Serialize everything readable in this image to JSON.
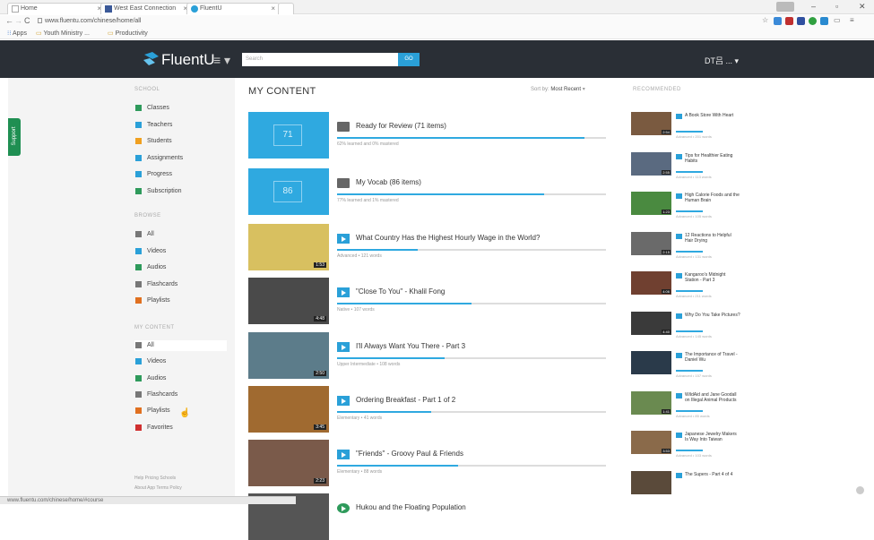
{
  "browser": {
    "tabs": [
      {
        "label": "Home"
      },
      {
        "label": "West East Connection"
      },
      {
        "label": "FluentU"
      }
    ],
    "url": "www.fluentu.com/chinese/home/all",
    "bookmarks": [
      "Apps",
      "Youth Ministry ...",
      "Productivity"
    ],
    "user_badge": "",
    "status_url": "www.fluentu.com/chinese/home/#course"
  },
  "header": {
    "logo_text": "FluentU",
    "search_placeholder": "Search",
    "go_label": "GO",
    "lang_label": "DT吕 ... ▾"
  },
  "sidebar": {
    "support_label": "Support",
    "school_heading": "SCHOOL",
    "school_items": [
      {
        "label": "Classes",
        "color": "#2e9a5b"
      },
      {
        "label": "Teachers",
        "color": "#2aa0d8"
      },
      {
        "label": "Students",
        "color": "#f0a020"
      },
      {
        "label": "Assignments",
        "color": "#2aa0d8"
      },
      {
        "label": "Progress",
        "color": "#2aa0d8"
      },
      {
        "label": "Subscription",
        "color": "#2e9a5b"
      }
    ],
    "browse_heading": "BROWSE",
    "browse_items": [
      {
        "label": "All",
        "color": "#777"
      },
      {
        "label": "Videos",
        "color": "#2aa0d8"
      },
      {
        "label": "Audios",
        "color": "#2e9a5b"
      },
      {
        "label": "Flashcards",
        "color": "#777"
      },
      {
        "label": "Playlists",
        "color": "#e07020"
      }
    ],
    "mycontent_heading": "MY CONTENT",
    "mycontent_items": [
      {
        "label": "All",
        "color": "#777"
      },
      {
        "label": "Videos",
        "color": "#2aa0d8"
      },
      {
        "label": "Audios",
        "color": "#2e9a5b"
      },
      {
        "label": "Flashcards",
        "color": "#777"
      },
      {
        "label": "Playlists",
        "color": "#e07020"
      },
      {
        "label": "Favorites",
        "color": "#d03030"
      }
    ],
    "footer_line1": "Help   Pricing   Schools",
    "footer_line2": "About   App   Terms   Policy"
  },
  "main": {
    "title": "MY CONTENT",
    "sort_label": "Sort by:",
    "sort_value": "Most Recent",
    "cards": [
      {
        "kind": "deck",
        "thumb_text": "71",
        "title": "Ready for Review (71 items)",
        "meta": "62% learned and 0% mastered",
        "progress": 0.92
      },
      {
        "kind": "deck",
        "thumb_text": "86",
        "title": "My Vocab (86 items)",
        "meta": "77% learned and 1% mastered",
        "progress": 0.77
      },
      {
        "kind": "video",
        "thumb_text": "",
        "duration": "1:53",
        "title": "What Country Has the Highest Hourly Wage in the World?",
        "meta": "Advanced • 121 words",
        "progress": 0.3,
        "thumb_color": "#d8c060"
      },
      {
        "kind": "video",
        "thumb_text": "",
        "duration": "4:48",
        "title": "\"Close To You\" - Khalil Fong",
        "meta": "Native • 107 words",
        "progress": 0.5,
        "thumb_color": "#4a4a4a"
      },
      {
        "kind": "video",
        "thumb_text": "",
        "duration": "2:50",
        "title": "I'll Always Want You There - Part 3",
        "meta": "Upper Intermediate • 108 words",
        "progress": 0.4,
        "thumb_color": "#5c7c8a"
      },
      {
        "kind": "video",
        "thumb_text": "",
        "duration": "3:45",
        "title": "Ordering Breakfast - Part 1 of 2",
        "meta": "Elementary • 41 words",
        "progress": 0.35,
        "thumb_color": "#a06a30"
      },
      {
        "kind": "video",
        "thumb_text": "",
        "duration": "2:23",
        "title": "\"Friends\" - Groovy Paul & Friends",
        "meta": "Elementary • 88 words",
        "progress": 0.45,
        "thumb_color": "#7a5a4a"
      },
      {
        "kind": "audio",
        "thumb_text": "",
        "duration": "",
        "title": "Hukou and the Floating Population",
        "meta": "",
        "progress": 0,
        "thumb_color": "#555"
      }
    ]
  },
  "recommended": {
    "heading": "RECOMMENDED",
    "items": [
      {
        "title": "A Book Store With Heart",
        "meta": "Advanced • 201 words",
        "duration": "2:54",
        "thumb_color": "#7a5a40"
      },
      {
        "title": "Tips for Healthier Eating Habits",
        "meta": "Advanced • 113 words",
        "duration": "2:55",
        "thumb_color": "#5a6a80"
      },
      {
        "title": "High Calorie Foods and the Human Brain",
        "meta": "Advanced • 105 words",
        "duration": "1:23",
        "thumb_color": "#4a8a40"
      },
      {
        "title": "12 Reactions to Helpful Hair Drying",
        "meta": "Advanced • 131 words",
        "duration": "2:15",
        "thumb_color": "#6a6a6a"
      },
      {
        "title": "Kangaroo's Midnight Station - Part 3",
        "meta": "Advanced • 211 words",
        "duration": "4:06",
        "thumb_color": "#704030"
      },
      {
        "title": "Why Do You Take Pictures?",
        "meta": "Advanced • 145 words",
        "duration": "4:40",
        "thumb_color": "#3a3a3a"
      },
      {
        "title": "The Importance of Travel - Daniel Wu",
        "meta": "Advanced • 157 words",
        "duration": "",
        "thumb_color": "#2a3a4a"
      },
      {
        "title": "WildAid and Jane Goodall on Illegal Animal Products",
        "meta": "Advanced • 85 words",
        "duration": "1:41",
        "thumb_color": "#6a8a50"
      },
      {
        "title": "Japanese Jewelry Makers Is Way Into Taiwan",
        "meta": "Advanced • 103 words",
        "duration": "3:53",
        "thumb_color": "#8a6a4a"
      },
      {
        "title": "The Supers - Part 4 of 4",
        "meta": "",
        "duration": "",
        "thumb_color": "#5a4a3a"
      }
    ]
  }
}
